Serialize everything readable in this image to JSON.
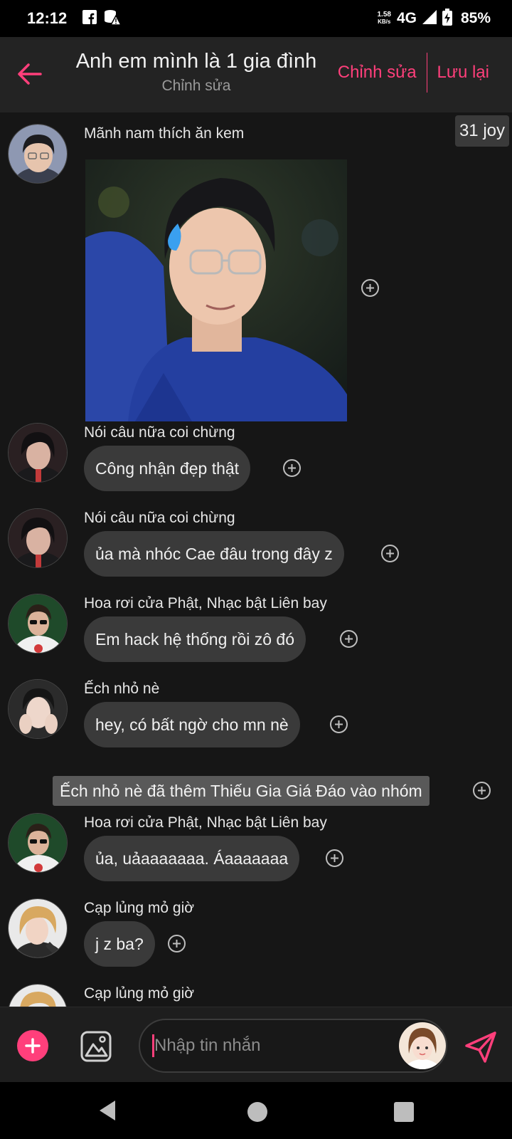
{
  "status_bar": {
    "time": "12:12",
    "net_speed_value": "1.58",
    "net_speed_unit": "KB/s",
    "network": "4G",
    "battery": "85%"
  },
  "header": {
    "title": "Anh em mình là 1 gia đình",
    "subtitle": "Chỉnh sửa",
    "edit_label": "Chỉnh sửa",
    "save_label": "Lưu lại"
  },
  "joy_badge": "31 joy",
  "messages": [
    {
      "sender": "Mãnh nam thích ăn kem",
      "type": "image",
      "avatar": "avatar-glasses-boy"
    },
    {
      "sender": "Nói câu nữa coi chừng",
      "text": "Công nhận đẹp thật",
      "avatar": "avatar-dark-hair"
    },
    {
      "sender": "Nói câu nữa coi chừng",
      "text": "ủa mà nhóc Cae đâu trong đây z",
      "avatar": "avatar-dark-hair"
    },
    {
      "sender": "Hoa rơi cửa Phật, Nhạc bật Liên bay",
      "text": "Em hack hệ thống rồi zô đó",
      "avatar": "avatar-sunglasses"
    },
    {
      "sender": "Ếch nhỏ nè",
      "text": "hey, có bất ngờ cho mn nè",
      "avatar": "avatar-hands-face"
    },
    {
      "system": "Ếch nhỏ nè đã thêm Thiếu Gia Giá Đáo vào nhóm"
    },
    {
      "sender": "Hoa rơi cửa Phật, Nhạc bật Liên bay",
      "text": "ủa, uảaaaaaaa. Áaaaaaaa",
      "avatar": "avatar-sunglasses"
    },
    {
      "sender": "Cạp lủng mỏ giờ",
      "text": "j z ba?",
      "avatar": "avatar-blond"
    },
    {
      "sender": "Cạp lủng mỏ giờ",
      "avatar": "avatar-blond"
    }
  ],
  "input": {
    "placeholder": "Nhập tin nhắn"
  },
  "colors": {
    "accent": "#ff3f7b",
    "background": "#161616",
    "bubble": "#3a3a3a",
    "header": "#232323"
  }
}
